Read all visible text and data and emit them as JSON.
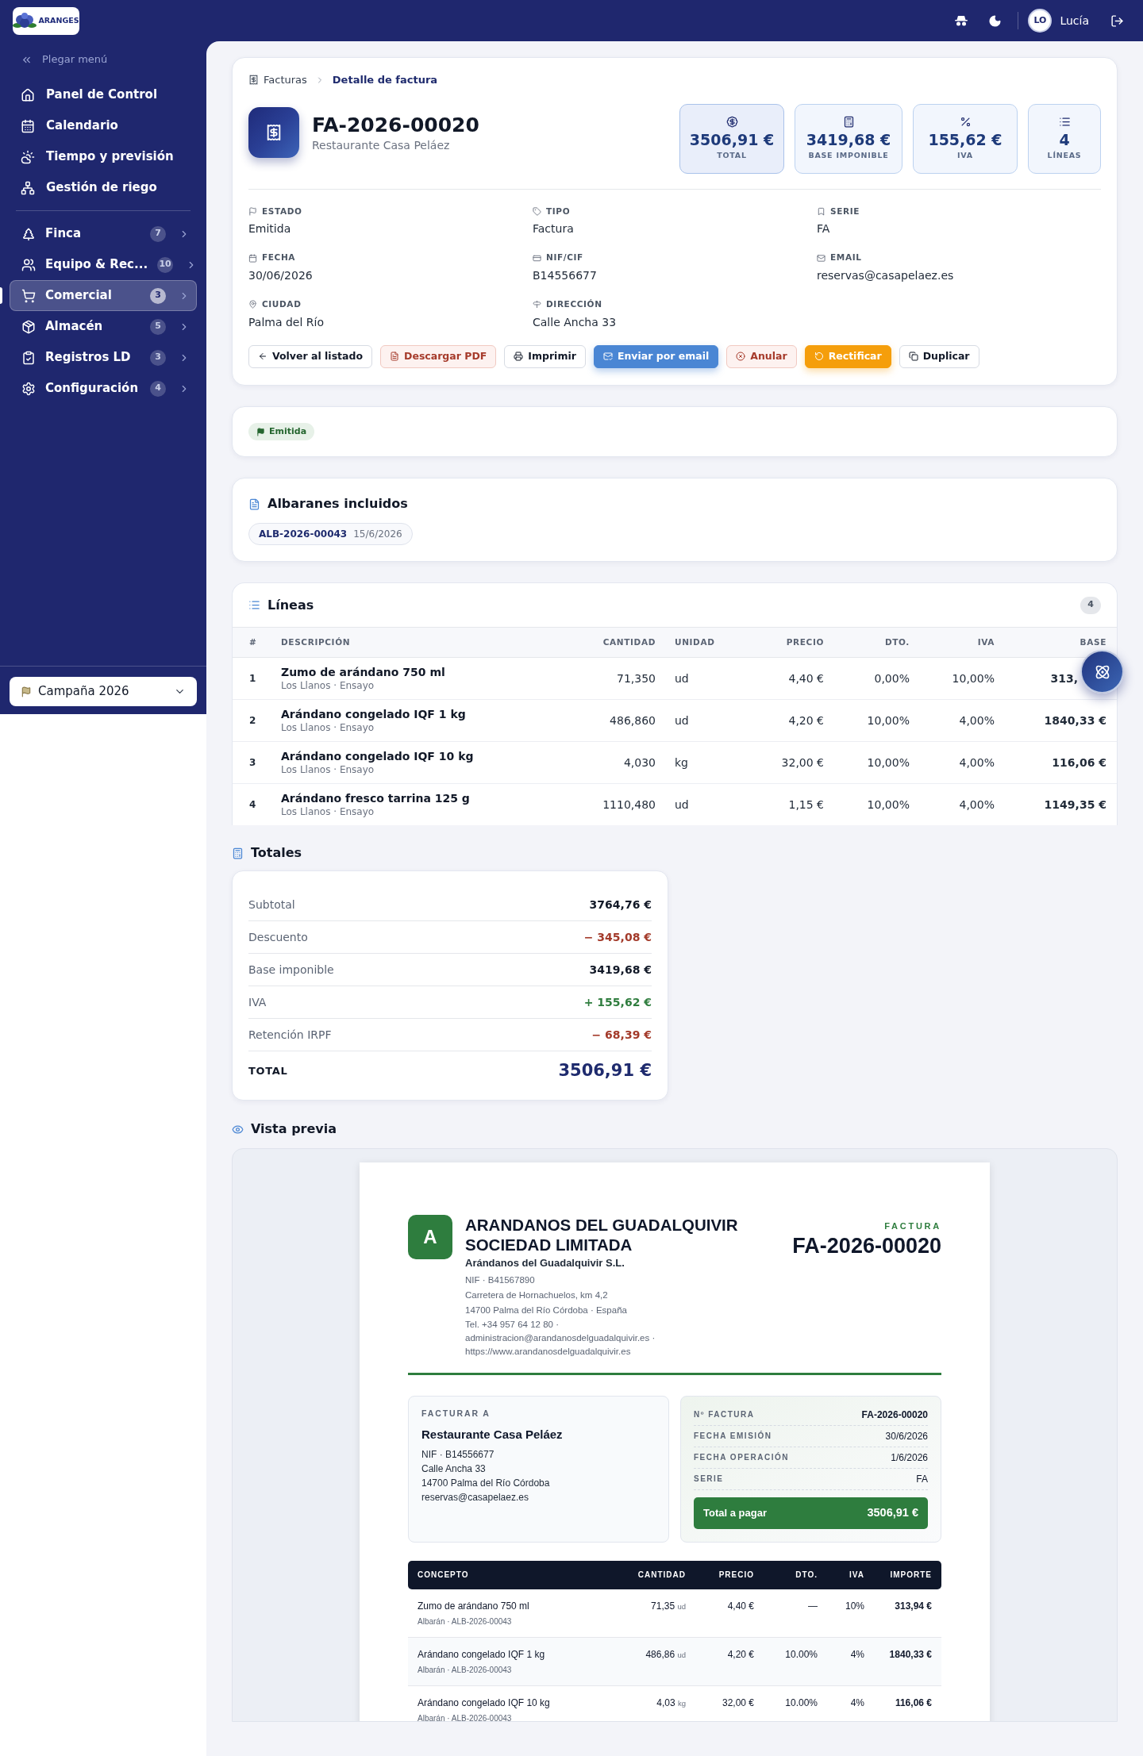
{
  "topbar": {
    "logo_text": "ARANGES",
    "user_initials": "LO",
    "user_name": "Lucía"
  },
  "sidebar": {
    "collapse_label": "Plegar menú",
    "main_items": [
      {
        "label": "Panel de Control",
        "selected": false
      },
      {
        "label": "Calendario",
        "selected": false
      },
      {
        "label": "Tiempo y previsión",
        "selected": false
      },
      {
        "label": "Gestión de riego",
        "selected": false
      }
    ],
    "section_items": [
      {
        "label": "Finca",
        "badge": "7",
        "selected": false
      },
      {
        "label": "Equipo & Rec...",
        "badge": "10",
        "selected": false
      },
      {
        "label": "Comercial",
        "badge": "3",
        "selected": true
      },
      {
        "label": "Almacén",
        "badge": "5",
        "selected": false
      },
      {
        "label": "Registros LD",
        "badge": "3",
        "selected": false
      },
      {
        "label": "Configuración",
        "badge": "4",
        "selected": false
      }
    ],
    "season": "Campaña 2026"
  },
  "invoice": {
    "breadcrumb": [
      "Facturas",
      "Detalle de factura"
    ],
    "title": "FA-2026-00020",
    "subtitle": "Restaurante Casa Peláez",
    "stats": [
      {
        "value": "3506,91 €",
        "label": "TOTAL",
        "highlighted": true
      },
      {
        "value": "3419,68 €",
        "label": "BASE IMPONIBLE",
        "highlighted": false
      },
      {
        "value": "155,62 €",
        "label": "IVA",
        "highlighted": false
      },
      {
        "value": "4",
        "label": "LÍNEAS",
        "highlighted": false
      }
    ],
    "fields": [
      {
        "label": "ESTADO",
        "value": "Emitida"
      },
      {
        "label": "TIPO",
        "value": "Factura"
      },
      {
        "label": "SERIE",
        "value": "FA"
      },
      {
        "label": "FECHA",
        "value": "30/06/2026"
      },
      {
        "label": "NIF/CIF",
        "value": "B14556677"
      },
      {
        "label": "EMAIL",
        "value": "reservas@casapelaez.es"
      },
      {
        "label": "CIUDAD",
        "value": "Palma del Río"
      },
      {
        "label": "DIRECCIÓN",
        "value": "Calle Ancha 33"
      }
    ],
    "actions": [
      {
        "label": "Volver al listado",
        "kind": "outline"
      },
      {
        "label": "Descargar PDF",
        "kind": "danger-soft"
      },
      {
        "label": "Imprimir",
        "kind": "outline"
      },
      {
        "label": "Enviar por email",
        "kind": "primary"
      },
      {
        "label": "Anular",
        "kind": "danger-soft"
      },
      {
        "label": "Rectificar",
        "kind": "warning"
      },
      {
        "label": "Duplicar",
        "kind": "outline"
      }
    ]
  },
  "status_badge": "Emitida",
  "delivery_notes": {
    "title": "Albaranes incluidos",
    "items": [
      {
        "code": "ALB-2026-00043",
        "date": "15/6/2026"
      }
    ]
  },
  "lines": {
    "title": "Líneas",
    "count": "4",
    "columns": [
      "#",
      "DESCRIPCIÓN",
      "CANTIDAD",
      "UNIDAD",
      "PRECIO",
      "DTO.",
      "IVA",
      "BASE"
    ],
    "rows": [
      {
        "num": "1",
        "description": "Zumo de arándano 750 ml",
        "meta": "Los Llanos · Ensayo",
        "quantity": "71,350",
        "unit": "ud",
        "price": "4,40 €",
        "discount": "0,00%",
        "vat": "10,00%",
        "base": "313,"
      },
      {
        "num": "2",
        "description": "Arándano congelado IQF 1 kg",
        "meta": "Los Llanos · Ensayo",
        "quantity": "486,860",
        "unit": "ud",
        "price": "4,20 €",
        "discount": "10,00%",
        "vat": "4,00%",
        "base": "1840,33 €"
      },
      {
        "num": "3",
        "description": "Arándano congelado IQF 10 kg",
        "meta": "Los Llanos · Ensayo",
        "quantity": "4,030",
        "unit": "kg",
        "price": "32,00 €",
        "discount": "10,00%",
        "vat": "4,00%",
        "base": "116,06 €"
      },
      {
        "num": "4",
        "description": "Arándano fresco tarrina 125 g",
        "meta": "Los Llanos · Ensayo",
        "quantity": "1110,480",
        "unit": "ud",
        "price": "1,15 €",
        "discount": "10,00%",
        "vat": "4,00%",
        "base": "1149,35 €"
      }
    ]
  },
  "totals": {
    "title": "Totales",
    "rows": [
      {
        "label": "Subtotal",
        "value": "3764,76 €",
        "color": "#111827"
      },
      {
        "label": "Descuento",
        "value": "− 345,08 €",
        "color": "#a33a2a"
      },
      {
        "label": "Base imponible",
        "value": "3419,68 €",
        "color": "#111827"
      },
      {
        "label": "IVA",
        "value": "+ 155,62 €",
        "color": "#2f7d3e"
      },
      {
        "label": "Retención IRPF",
        "value": "− 68,39 €",
        "color": "#a33a2a"
      }
    ],
    "total_label": "TOTAL",
    "total_value": "3506,91 €"
  },
  "preview": {
    "title": "Vista previa",
    "company": {
      "initial": "A",
      "name": "ARANDANOS DEL GUADALQUIVIR SOCIEDAD LIMITADA",
      "trade_name": "Arándanos del Guadalquivir S.L.",
      "lines": [
        "NIF · B41567890",
        "Carretera de Hornachuelos, km 4,2",
        "14700 Palma del Río Córdoba · España",
        "Tel. +34 957 64 12 80 ·",
        "administracion@arandanosdelguadalquivir.es ·",
        "https://www.arandanosdelguadalquivir.es"
      ]
    },
    "doc_type": "FACTURA",
    "doc_number": "FA-2026-00020",
    "bill_to": {
      "heading": "FACTURAR A",
      "name": "Restaurante Casa Peláez",
      "lines": [
        "NIF · B14556677",
        "Calle Ancha 33",
        "14700 Palma del Río Córdoba",
        "reservas@casapelaez.es"
      ]
    },
    "meta": [
      {
        "label": "Nº FACTURA",
        "value": "FA-2026-00020"
      },
      {
        "label": "FECHA EMISIÓN",
        "value": "30/6/2026"
      },
      {
        "label": "FECHA OPERACIÓN",
        "value": "1/6/2026"
      },
      {
        "label": "SERIE",
        "value": "FA"
      }
    ],
    "total_due": {
      "label": "Total a pagar",
      "value": "3506,91 €"
    },
    "columns": [
      "CONCEPTO",
      "CANTIDAD",
      "PRECIO",
      "DTO.",
      "IVA",
      "IMPORTE"
    ],
    "rows": [
      {
        "concept": "Zumo de arándano 750 ml",
        "ref": "Albarán · ALB-2026-00043",
        "quantity": "71,35",
        "unit": "ud",
        "price": "4,40 €",
        "discount": "—",
        "vat": "10%",
        "amount": "313,94 €"
      },
      {
        "concept": "Arándano congelado IQF 1 kg",
        "ref": "Albarán · ALB-2026-00043",
        "quantity": "486,86",
        "unit": "ud",
        "price": "4,20 €",
        "discount": "10.00%",
        "vat": "4%",
        "amount": "1840,33 €"
      },
      {
        "concept": "Arándano congelado IQF 10 kg",
        "ref": "Albarán · ALB-2026-00043",
        "quantity": "4,03",
        "unit": "kg",
        "price": "32,00 €",
        "discount": "10.00%",
        "vat": "4%",
        "amount": "116,06 €"
      }
    ]
  }
}
